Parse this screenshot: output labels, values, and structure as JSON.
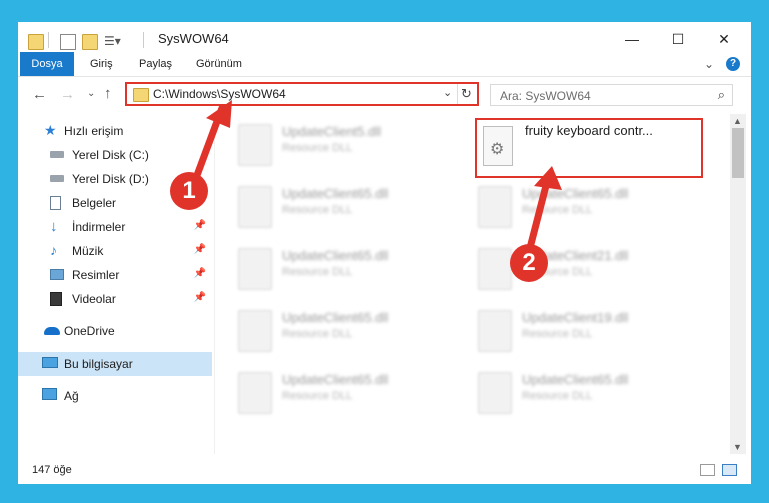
{
  "window": {
    "title": "SysWOW64",
    "minimize": "—",
    "maximize": "☐",
    "close": "✕"
  },
  "ribbon": {
    "tabs": [
      "Dosya",
      "Giriş",
      "Paylaş",
      "Görünüm"
    ],
    "collapse": "⌄",
    "help": "?"
  },
  "address": {
    "path": "C:\\Windows\\SysWOW64",
    "search_placeholder": "Ara: SysWOW64"
  },
  "nav": {
    "items": [
      {
        "label": "Hızlı erişim",
        "icon": "star-icon"
      },
      {
        "label": "Yerel Disk (C:)",
        "icon": "drive-icon"
      },
      {
        "label": "Yerel Disk (D:)",
        "icon": "drive-icon"
      },
      {
        "label": "Belgeler",
        "icon": "documents-icon"
      },
      {
        "label": "İndirmeler",
        "icon": "download-icon"
      },
      {
        "label": "Müzik",
        "icon": "music-icon"
      },
      {
        "label": "Resimler",
        "icon": "pictures-icon"
      },
      {
        "label": "Videolar",
        "icon": "video-icon"
      },
      {
        "label": "OneDrive",
        "icon": "cloud-icon"
      },
      {
        "label": "Bu bilgisayar",
        "icon": "computer-icon"
      },
      {
        "label": "Ağ",
        "icon": "network-icon"
      }
    ]
  },
  "files": {
    "selected": "fruity keyboard contr...",
    "left_col": [
      {
        "name": "UpdateClient5.dll",
        "type": "Resource DLL"
      },
      {
        "name": "UpdateClient65.dll",
        "type": "Resource DLL"
      },
      {
        "name": "UpdateClient65.dll",
        "type": "Resource DLL"
      },
      {
        "name": "UpdateClient65.dll",
        "type": "Resource DLL"
      },
      {
        "name": "UpdateClient65.dll",
        "type": "Resource DLL"
      }
    ],
    "right_col": [
      {
        "name": "UpdateClient65.dll",
        "type": "Resource DLL"
      },
      {
        "name": "UpdateClient21.dll",
        "type": "Resource DLL"
      },
      {
        "name": "UpdateClient19.dll",
        "type": "Resource DLL"
      },
      {
        "name": "UpdateClient65.dll",
        "type": "Resource DLL"
      }
    ]
  },
  "status": {
    "count": "147 öğe"
  },
  "annotations": {
    "step1": "1",
    "step2": "2",
    "color": "#e0342b"
  }
}
